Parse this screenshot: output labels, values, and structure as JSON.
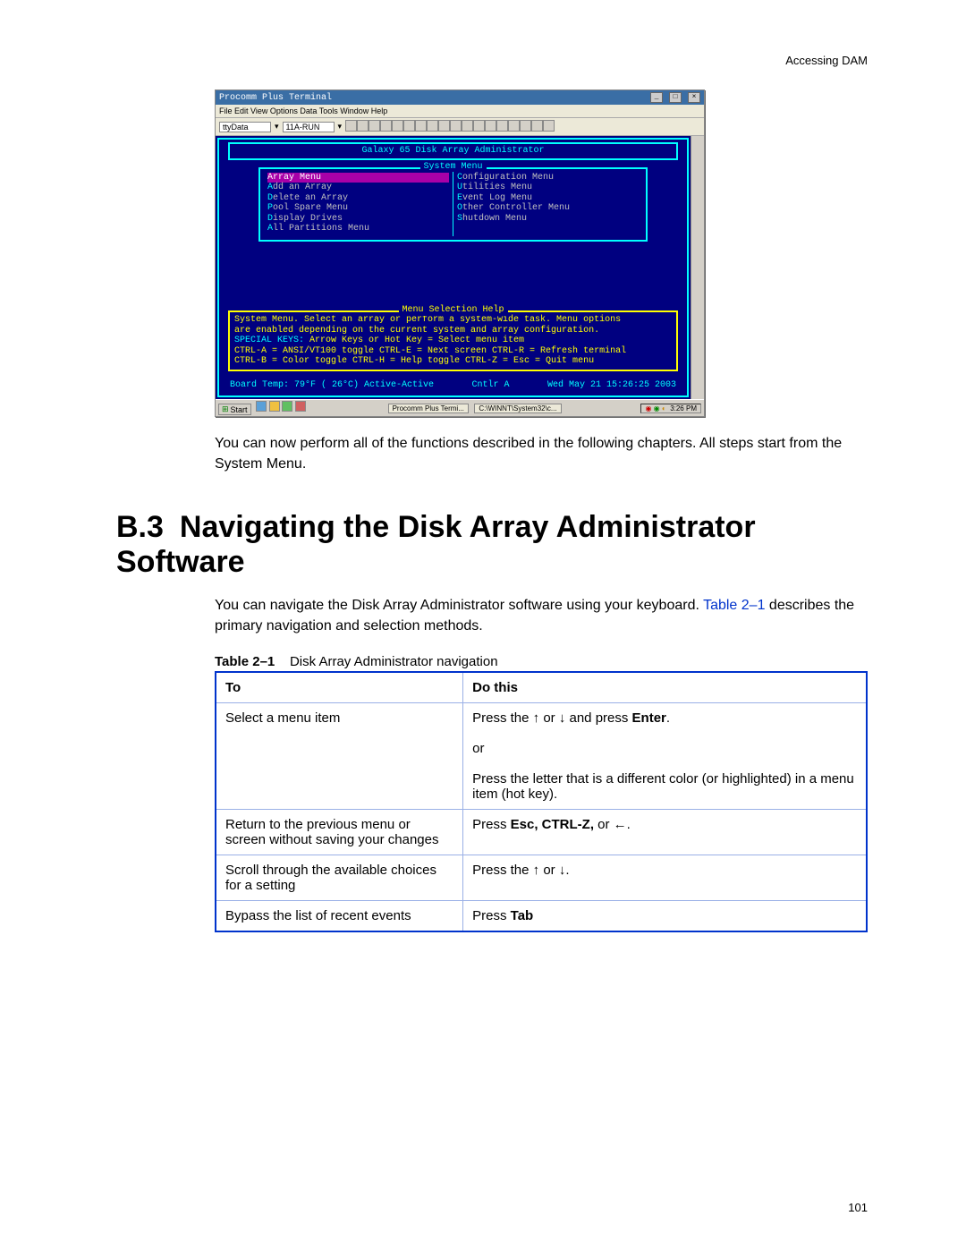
{
  "running_head": "Accessing DAM",
  "page_number": "101",
  "intro_para": "You can now perform all of the functions described in the following chapters. All steps start from the System Menu.",
  "section": {
    "number": "B.3",
    "title": "Navigating the Disk Array Administrator Software"
  },
  "section_para_pre": "You can navigate the Disk Array Administrator software using your keyboard. ",
  "section_para_ref": "Table 2–1",
  "section_para_post": " describes the primary navigation and selection methods.",
  "table": {
    "caption_label": "Table 2–1",
    "caption_text": "Disk Array Administrator navigation",
    "headers": {
      "c1": "To",
      "c2": "Do this"
    },
    "rows": [
      {
        "c1": "Select a menu item",
        "c2_line1_pre": "Press the ",
        "c2_line1_arrow1": "↑",
        "c2_line1_mid": " or ",
        "c2_line1_arrow2": "↓",
        "c2_line1_post": " and press ",
        "c2_line1_bold": "Enter",
        "c2_line1_end": ".",
        "c2_or": "or",
        "c2_line2": "Press the letter that is a different color (or highlighted) in a menu item (hot key)."
      },
      {
        "c1": "Return to the previous menu or screen without saving your changes",
        "c2_pre": "Press ",
        "c2_bold": "Esc, CTRL-Z,",
        "c2_mid": " or ",
        "c2_arrow": "←",
        "c2_end": "."
      },
      {
        "c1": "Scroll through the available choices for a setting",
        "c2_pre": "Press the ",
        "c2_arrow1": "↑",
        "c2_mid": " or ",
        "c2_arrow2": "↓",
        "c2_end": "."
      },
      {
        "c1": "Bypass the list of recent events",
        "c2_pre": "Press ",
        "c2_bold": "Tab"
      }
    ]
  },
  "terminal": {
    "window_title": "Procomm Plus Terminal",
    "menubar": "File  Edit  View  Options  Data  Tools  Window  Help",
    "combo1": "ttyData",
    "combo2": "11A-RUN",
    "header": "Galaxy 65 Disk Array Administrator",
    "system_menu_title": "System Menu",
    "left_menu": [
      {
        "hk": "A",
        "rest": "rray Menu",
        "selected": true
      },
      {
        "hk": "A",
        "rest": "dd an Array"
      },
      {
        "hk": "D",
        "rest": "elete an Array"
      },
      {
        "hk": "P",
        "rest": "ool Spare Menu"
      },
      {
        "hk": "D",
        "rest": "isplay Drives"
      },
      {
        "hk": "A",
        "rest": "ll Partitions Menu"
      }
    ],
    "right_menu": [
      {
        "hk": "C",
        "rest": "onfiguration Menu"
      },
      {
        "hk": "U",
        "rest": "tilities Menu"
      },
      {
        "hk": "E",
        "rest": "vent Log Menu"
      },
      {
        "hk": "O",
        "rest": "ther Controller Menu"
      },
      {
        "hk": "S",
        "rest": "hutdown Menu"
      }
    ],
    "help_title": "Menu Selection Help",
    "help_lines": [
      "System Menu.  Select an array or perform a system-wide task.  Menu options",
      "are enabled depending on the current system and array configuration.",
      "SPECIAL KEYS:            Arrow Keys or Hot Key = Select menu item",
      "CTRL-A = ANSI/VT100 toggle  CTRL-E = Next screen  CTRL-R = Refresh terminal",
      "CTRL-B = Color toggle      CTRL-H = Help toggle  CTRL-Z = Esc = Quit menu"
    ],
    "status_left": "Board Temp:  79°F ( 26°C)  Active-Active",
    "status_mid": "Cntlr A",
    "status_right": "Wed May 21 15:26:25 2003",
    "taskbar_start": "Start",
    "taskbar_task1": "Procomm Plus Termi...",
    "taskbar_task2": "C:\\WINNT\\System32\\c...",
    "taskbar_time": "3:26 PM"
  }
}
